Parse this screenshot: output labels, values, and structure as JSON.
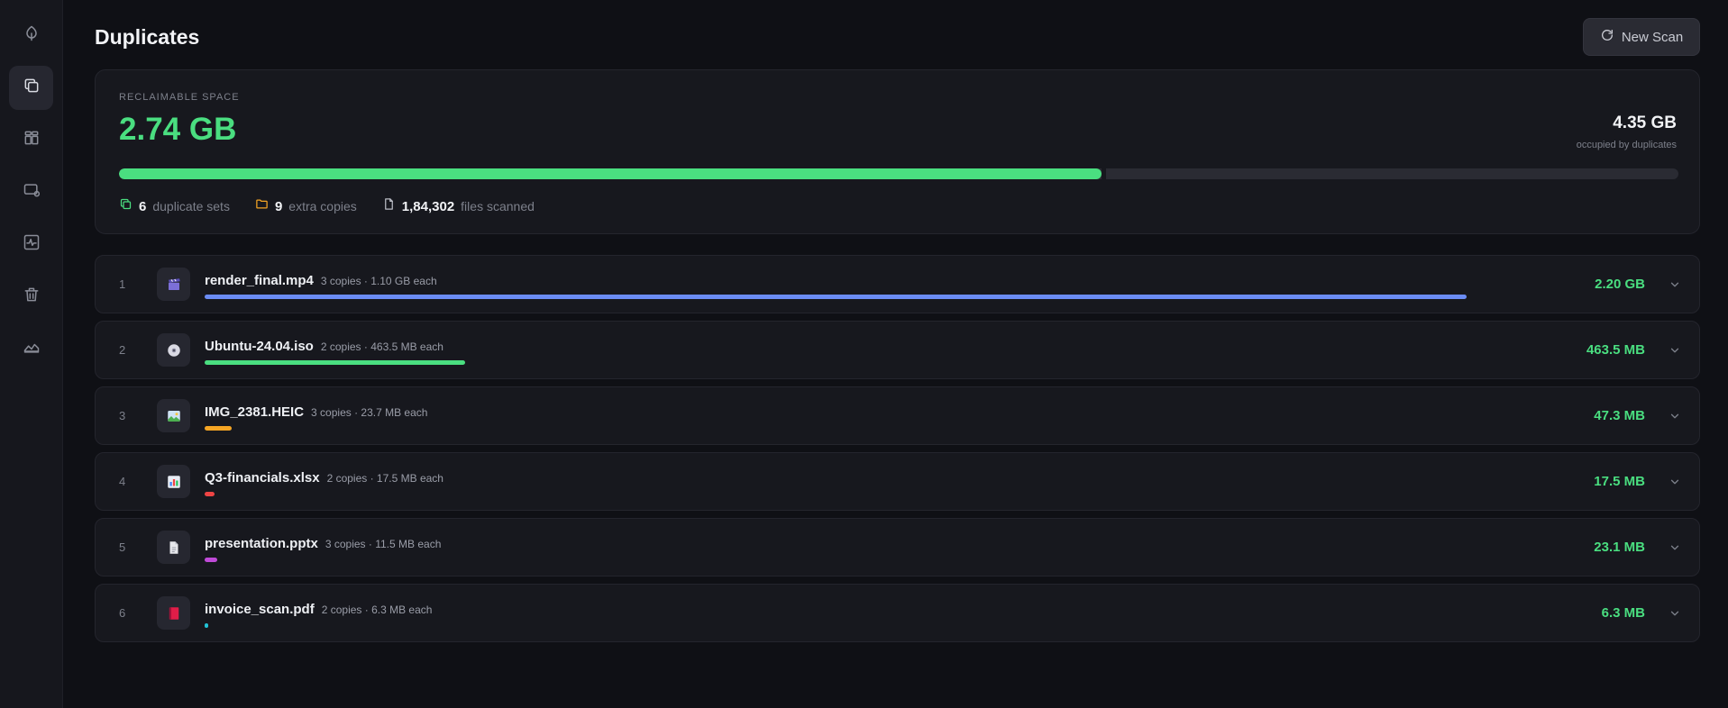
{
  "page": {
    "title": "Duplicates"
  },
  "toolbar": {
    "new_scan_label": "New Scan"
  },
  "summary": {
    "label": "RECLAIMABLE SPACE",
    "reclaimable": "2.74 GB",
    "occupied": "4.35 GB",
    "occupied_label": "occupied by duplicates",
    "reclaimable_fraction": 0.63
  },
  "stats": {
    "sets_count": "6",
    "sets_label": "duplicate sets",
    "copies_count": "9",
    "copies_label": "extra copies",
    "files_count": "1,84,302",
    "files_label": "files scanned"
  },
  "sidebar": {
    "items": [
      {
        "name": "leaf-icon",
        "active": false
      },
      {
        "name": "copy-icon",
        "active": true
      },
      {
        "name": "grid-icon",
        "active": false
      },
      {
        "name": "monitor-icon",
        "active": false
      },
      {
        "name": "activity-icon",
        "active": false
      },
      {
        "name": "trash-icon",
        "active": false
      },
      {
        "name": "area-chart-icon",
        "active": false
      }
    ]
  },
  "colors": {
    "accent": "#4ade80",
    "video": "#6b8cf5",
    "iso": "#4ade80",
    "image": "#f5a524",
    "sheet": "#ef4444",
    "slides": "#c04ad8",
    "pdf": "#22c3d6"
  },
  "duplicates": [
    {
      "index": "1",
      "name": "render_final.mp4",
      "meta": "3 copies · 1.10 GB each",
      "size": "2.20 GB",
      "icon": "clapperboard-icon",
      "color": "#6b8cf5",
      "fraction": 0.8
    },
    {
      "index": "2",
      "name": "Ubuntu-24.04.iso",
      "meta": "2 copies · 463.5 MB each",
      "size": "463.5 MB",
      "icon": "disc-icon",
      "color": "#4ade80",
      "fraction": 0.165
    },
    {
      "index": "3",
      "name": "IMG_2381.HEIC",
      "meta": "3 copies · 23.7 MB each",
      "size": "47.3 MB",
      "icon": "picture-icon",
      "color": "#f5a524",
      "fraction": 0.017
    },
    {
      "index": "4",
      "name": "Q3-financials.xlsx",
      "meta": "2 copies · 17.5 MB each",
      "size": "17.5 MB",
      "icon": "bar-chart-icon",
      "color": "#ef4444",
      "fraction": 0.006
    },
    {
      "index": "5",
      "name": "presentation.pptx",
      "meta": "3 copies · 11.5 MB each",
      "size": "23.1 MB",
      "icon": "document-icon",
      "color": "#c04ad8",
      "fraction": 0.008
    },
    {
      "index": "6",
      "name": "invoice_scan.pdf",
      "meta": "2 copies · 6.3 MB each",
      "size": "6.3 MB",
      "icon": "red-book-icon",
      "color": "#22c3d6",
      "fraction": 0.002
    }
  ]
}
